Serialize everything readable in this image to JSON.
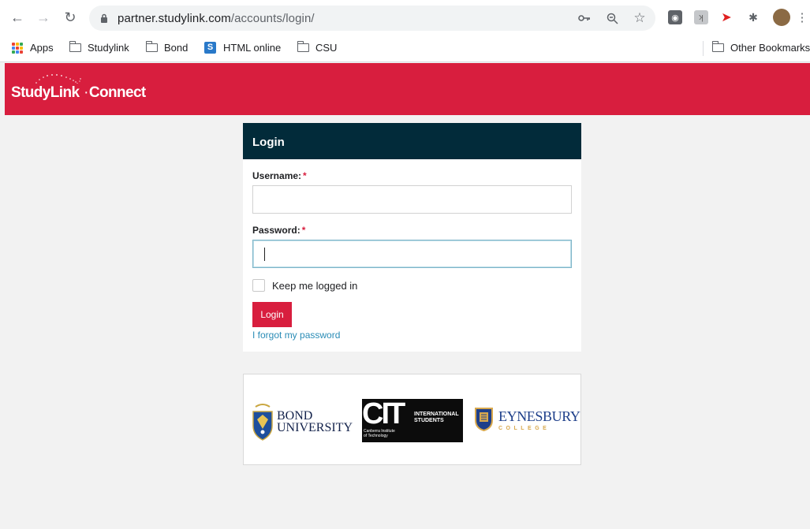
{
  "browser": {
    "url_host": "partner.studylink.com",
    "url_path": "/accounts/login/"
  },
  "bookmarks": {
    "items": [
      {
        "label": "Apps"
      },
      {
        "label": "Studylink"
      },
      {
        "label": "Bond"
      },
      {
        "label": "HTML online"
      },
      {
        "label": "CSU"
      }
    ],
    "other": "Other Bookmarks"
  },
  "header": {
    "logo_study": "StudyLink",
    "logo_connect": "Connect"
  },
  "login": {
    "title": "Login",
    "username_label": "Username:",
    "username_value": "",
    "password_label": "Password:",
    "password_value": "",
    "required_mark": "*",
    "remember_label": "Keep me logged in",
    "button_label": "Login",
    "forgot_link": "I forgot my password"
  },
  "partners": {
    "bond_line1": "BOND",
    "bond_line2": "UNIVERSITY",
    "cit_letters": "CIT",
    "cit_intl_line1": "INTERNATIONAL",
    "cit_intl_line2": "STUDENTS",
    "cit_name_line1": "Canberra Institute",
    "cit_name_line2": "of Technology",
    "eyn_title": "EYNESBURY",
    "eyn_sub": "COLLEGE"
  }
}
